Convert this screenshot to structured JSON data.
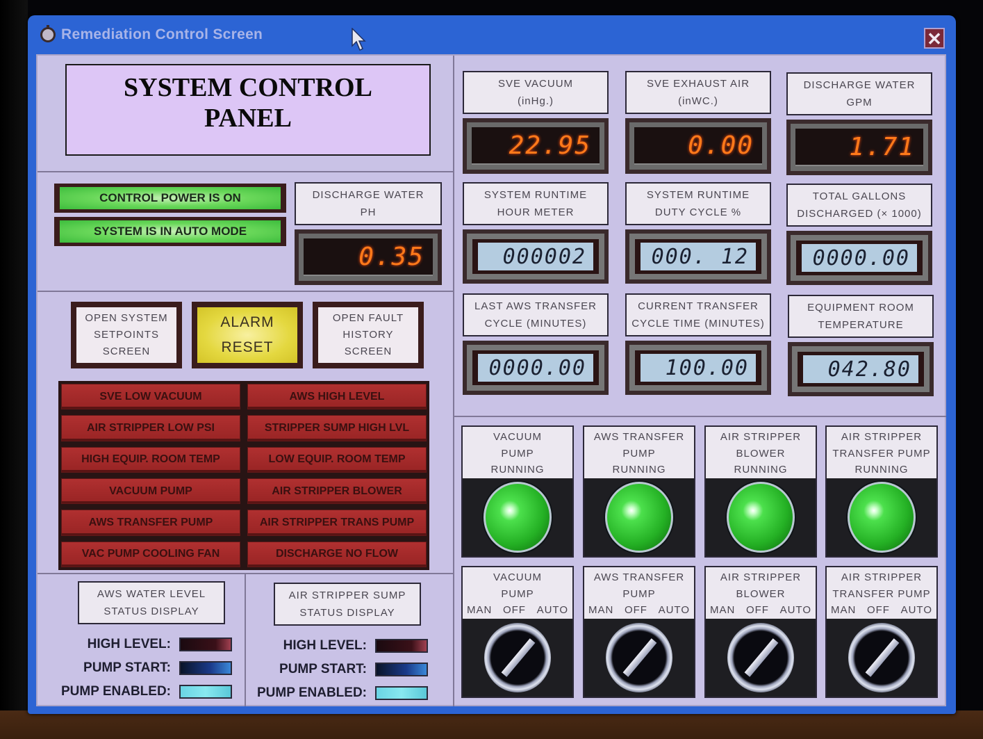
{
  "window": {
    "title": "Remediation Control Screen",
    "close_label": "✕"
  },
  "header": {
    "title_line1": "SYSTEM CONTROL",
    "title_line2": "PANEL"
  },
  "status_lamps": [
    {
      "label": "CONTROL POWER IS ON",
      "state": "on",
      "color": "#4cc84c"
    },
    {
      "label": "SYSTEM IS IN AUTO MODE",
      "state": "on",
      "color": "#4cc84c"
    }
  ],
  "ph_meter": {
    "label_line1": "DISCHARGE WATER",
    "label_line2": "PH",
    "value": "0.35"
  },
  "led_meters": [
    {
      "label_line1": "SVE VACUUM",
      "label_line2": "(inHg.)",
      "value": "22.95"
    },
    {
      "label_line1": "SVE EXHAUST AIR",
      "label_line2": "(inWC.)",
      "value": "0.00"
    },
    {
      "label_line1": "DISCHARGE WATER",
      "label_line2": "GPM",
      "value": "1.71"
    }
  ],
  "lcd_meters": [
    {
      "label_line1": "SYSTEM RUNTIME",
      "label_line2": "HOUR METER",
      "value": "000002"
    },
    {
      "label_line1": "SYSTEM RUNTIME",
      "label_line2": "DUTY CYCLE %",
      "value": "000. 12"
    },
    {
      "label_line1": "TOTAL GALLONS",
      "label_line2": "DISCHARGED (× 1000)",
      "value": "0000.00"
    },
    {
      "label_line1": "LAST AWS TRANSFER",
      "label_line2": "CYCLE (MINUTES)",
      "value": "0000.00"
    },
    {
      "label_line1": "CURRENT TRANSFER",
      "label_line2": "CYCLE TIME (MINUTES)",
      "value": "100.00"
    },
    {
      "label_line1": "EQUIPMENT ROOM",
      "label_line2": "TEMPERATURE",
      "value": "042.80"
    }
  ],
  "command_buttons": [
    {
      "lines": [
        "OPEN SYSTEM",
        "SETPOINTS",
        "SCREEN"
      ]
    },
    {
      "lines": [
        "ALARM",
        "RESET"
      ]
    },
    {
      "lines": [
        "OPEN FAULT",
        "HISTORY",
        "SCREEN"
      ]
    }
  ],
  "alarms": [
    "SVE LOW VACUUM",
    "AWS HIGH LEVEL",
    "AIR STRIPPER LOW PSI",
    "STRIPPER SUMP HIGH LVL",
    "HIGH EQUIP. ROOM TEMP",
    "LOW EQUIP. ROOM TEMP",
    "VACUUM PUMP",
    "AIR STRIPPER BLOWER",
    "AWS TRANSFER PUMP",
    "AIR STRIPPER TRANS PUMP",
    "VAC PUMP COOLING FAN",
    "DISCHARGE NO FLOW"
  ],
  "status_displays": [
    {
      "title_line1": "AWS WATER LEVEL",
      "title_line2": "STATUS DISPLAY",
      "rows": [
        {
          "label": "HIGH LEVEL:",
          "state": "off"
        },
        {
          "label": "PUMP START:",
          "state": "off"
        },
        {
          "label": "PUMP ENABLED:",
          "state": "on"
        }
      ]
    },
    {
      "title_line1": "AIR STRIPPER SUMP",
      "title_line2": "STATUS DISPLAY",
      "rows": [
        {
          "label": "HIGH LEVEL:",
          "state": "off"
        },
        {
          "label": "PUMP START:",
          "state": "off"
        },
        {
          "label": "PUMP ENABLED:",
          "state": "on"
        }
      ]
    }
  ],
  "running_lights": [
    {
      "lines": [
        "VACUUM",
        "PUMP",
        "RUNNING"
      ],
      "state": "on"
    },
    {
      "lines": [
        "AWS TRANSFER",
        "PUMP",
        "RUNNING"
      ],
      "state": "on"
    },
    {
      "lines": [
        "AIR STRIPPER",
        "BLOWER",
        "RUNNING"
      ],
      "state": "on"
    },
    {
      "lines": [
        "AIR STRIPPER",
        "TRANSFER PUMP",
        "RUNNING"
      ],
      "state": "on"
    }
  ],
  "selector_switches": [
    {
      "lines": [
        "VACUUM",
        "PUMP"
      ],
      "modes": [
        "MAN",
        "OFF",
        "AUTO"
      ],
      "position": "AUTO"
    },
    {
      "lines": [
        "AWS TRANSFER",
        "PUMP"
      ],
      "modes": [
        "MAN",
        "OFF",
        "AUTO"
      ],
      "position": "AUTO"
    },
    {
      "lines": [
        "AIR STRIPPER",
        "BLOWER"
      ],
      "modes": [
        "MAN",
        "OFF",
        "AUTO"
      ],
      "position": "AUTO"
    },
    {
      "lines": [
        "AIR STRIPPER",
        "TRANSFER PUMP"
      ],
      "modes": [
        "MAN",
        "OFF",
        "AUTO"
      ],
      "position": "AUTO"
    }
  ]
}
